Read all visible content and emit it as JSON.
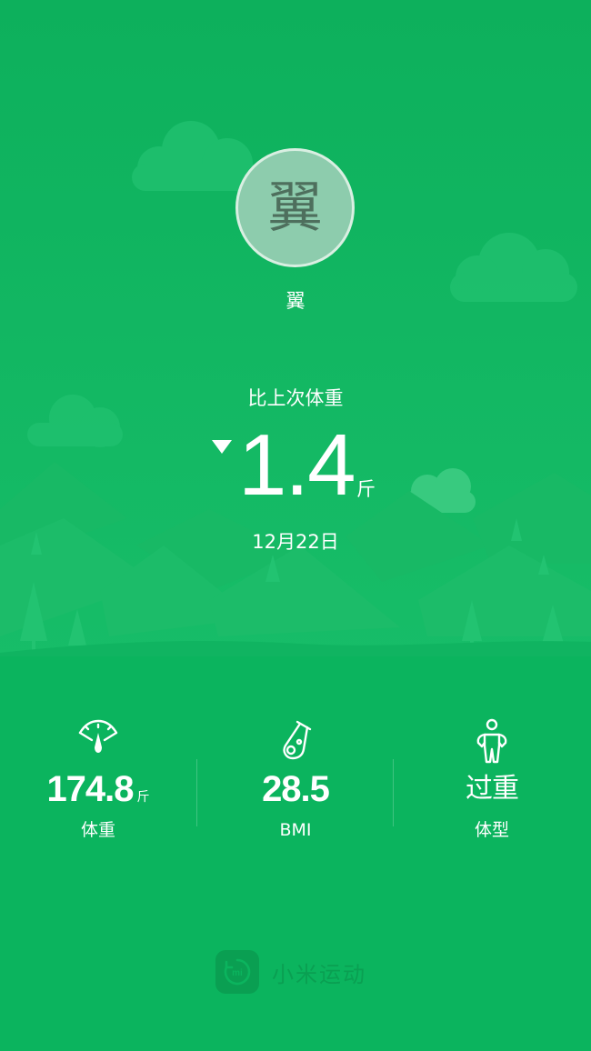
{
  "colors": {
    "background": "#0bb45e",
    "text": "#ffffff",
    "avatar_fill": "#8dccad",
    "brand": "#0a9f52"
  },
  "profile": {
    "avatar_text": "翼",
    "name": "翼"
  },
  "summary": {
    "compare_label": "比上次体重",
    "direction": "down",
    "delta": "1.4",
    "unit": "斤",
    "date": "12月22日"
  },
  "stats": [
    {
      "icon": "scale-icon",
      "value": "174.8",
      "unit": "斤",
      "label": "体重"
    },
    {
      "icon": "bmi-flask-icon",
      "value": "28.5",
      "label": "BMI"
    },
    {
      "icon": "body-figure-icon",
      "value": "过重",
      "label": "体型"
    }
  ],
  "footer": {
    "logo_text": "mi",
    "brand_name": "小米运动"
  }
}
